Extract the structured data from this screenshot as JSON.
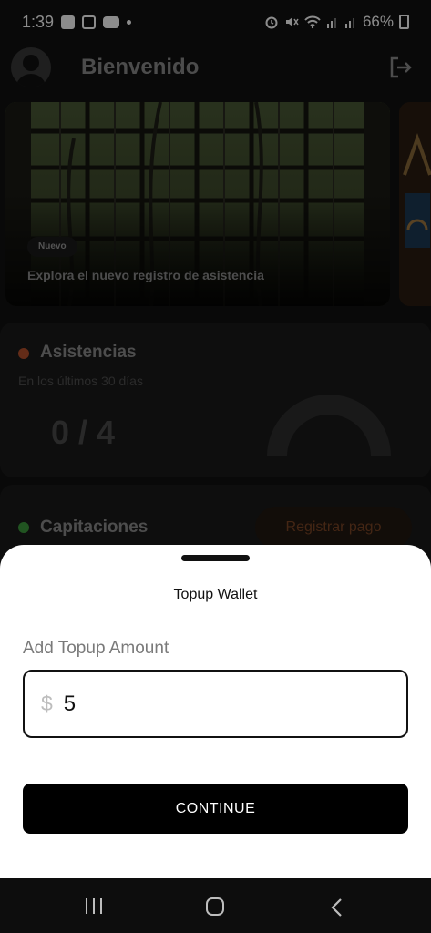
{
  "status_bar": {
    "time": "1:39",
    "battery": "66%"
  },
  "header": {
    "welcome": "Bienvenido",
    "avatar_icon": "user-avatar-icon",
    "logout_icon": "logout-icon"
  },
  "banner": {
    "badge": "Nuevo",
    "text": "Explora el nuevo registro de asistencia"
  },
  "attendance": {
    "title": "Asistencias",
    "subtitle": "En los últimos 30 días",
    "count": "0 / 4",
    "dot_color": "#b5512c"
  },
  "capitaciones": {
    "title": "Capitaciones",
    "button": "Registrar pago",
    "dot_color": "#3d9a3d"
  },
  "sheet": {
    "title": "Topup Wallet",
    "amount_label": "Add Topup Amount",
    "currency": "$",
    "amount_value": "5",
    "continue": "CONTINUE"
  },
  "nav": {
    "recents_icon": "recents-icon",
    "home_icon": "home-icon",
    "back_icon": "back-icon"
  }
}
